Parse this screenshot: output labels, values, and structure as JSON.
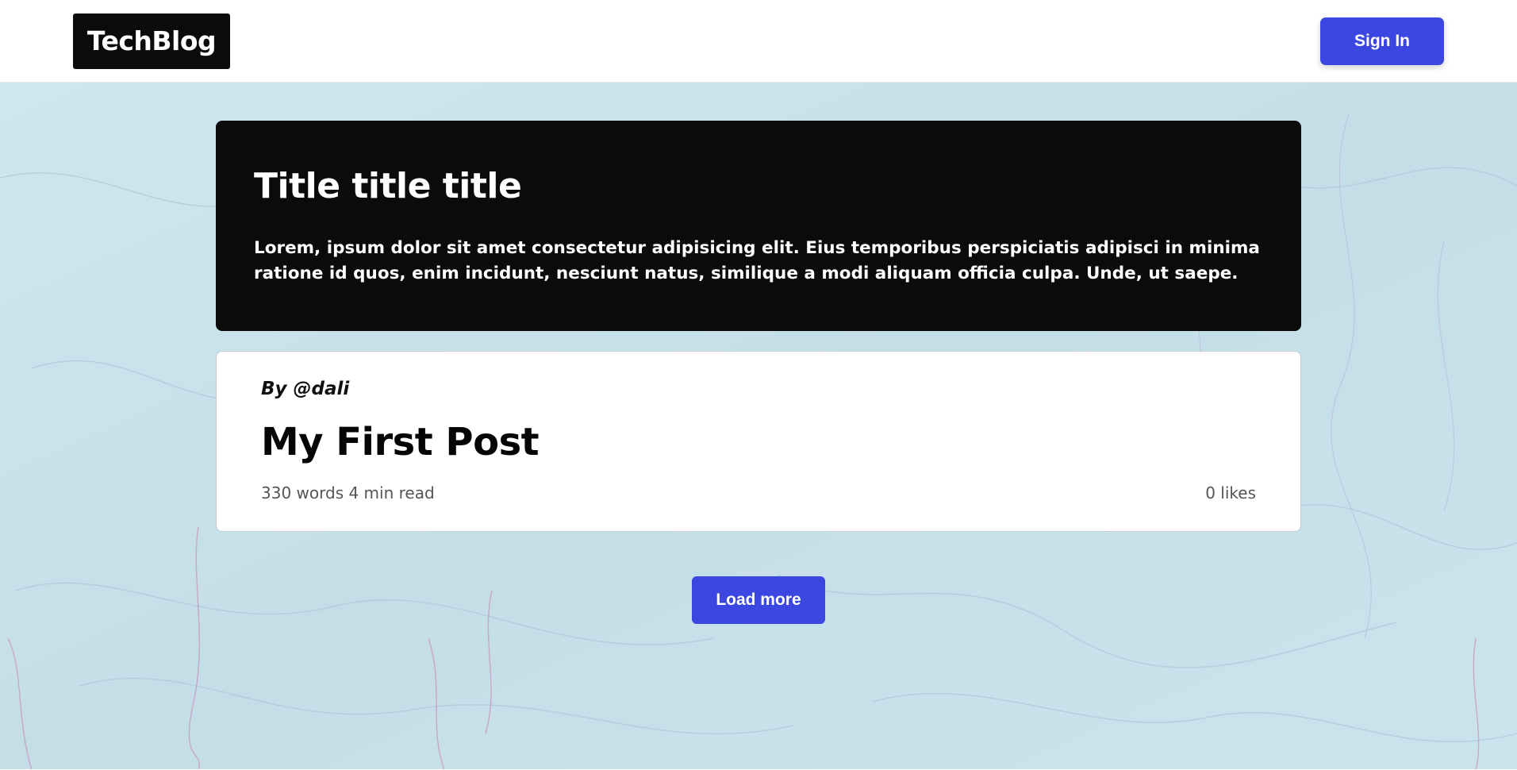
{
  "header": {
    "logo_text": "TechBlog",
    "signin_label": "Sign In"
  },
  "hero": {
    "title": "Title title title",
    "description": "Lorem, ipsum dolor sit amet consectetur adipisicing elit. Eius temporibus perspiciatis adipisci in minima ratione id quos, enim incidunt, nesciunt natus, similique a modi aliquam officia culpa. Unde, ut saepe."
  },
  "posts": [
    {
      "author": "By @dali",
      "title": "My First Post",
      "meta": "330 words 4 min read",
      "likes": "0 likes"
    }
  ],
  "load_more_label": "Load more",
  "colors": {
    "accent": "#3b47e0",
    "dark_panel": "#0b0b0b",
    "background": "#c9e2ea"
  }
}
